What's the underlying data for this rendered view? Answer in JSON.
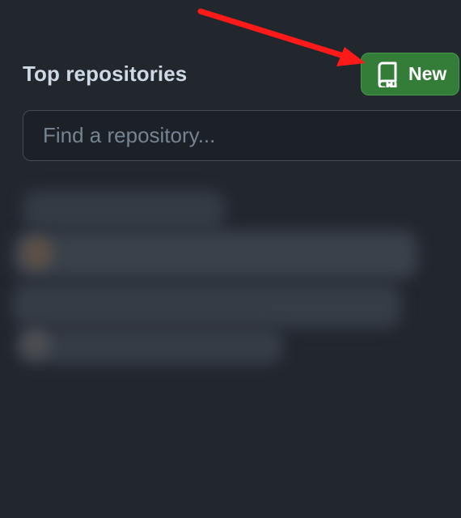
{
  "panel": {
    "title": "Top repositories",
    "new_button_label": "New",
    "new_button_icon": "repo-icon"
  },
  "search": {
    "placeholder": "Find a repository...",
    "value": ""
  },
  "colors": {
    "background": "#22272e",
    "button_green": "#347d39",
    "annotation_arrow": "#ff1a1a"
  }
}
